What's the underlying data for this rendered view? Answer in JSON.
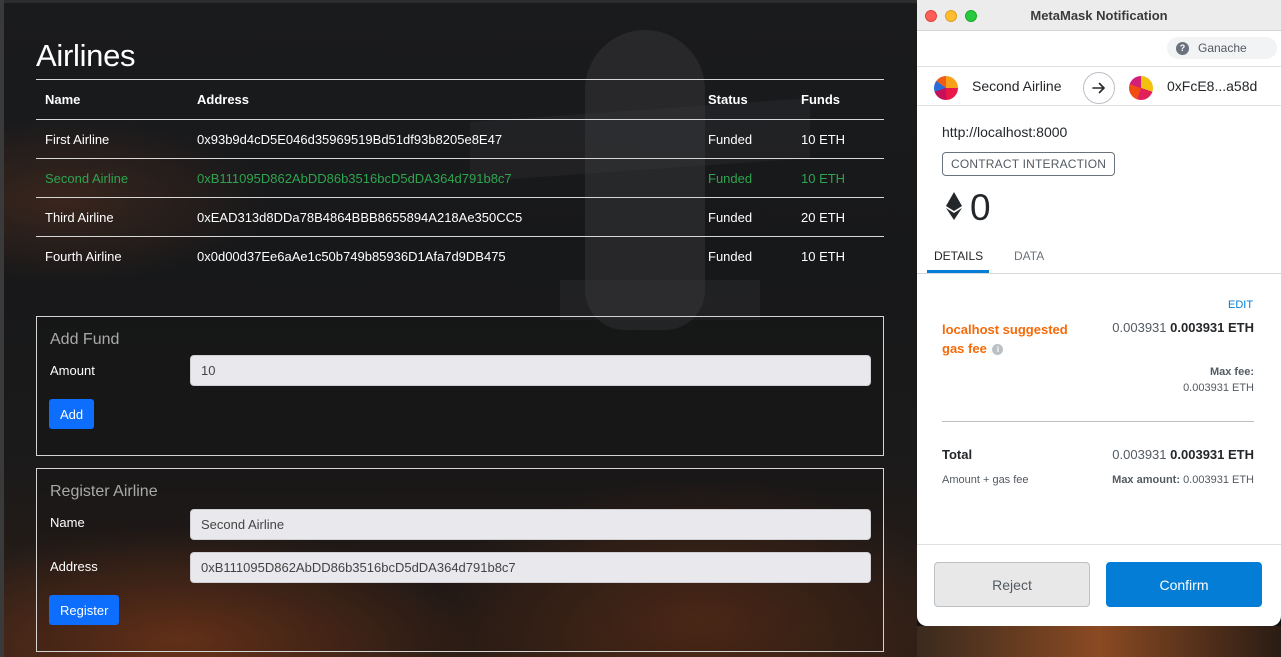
{
  "app": {
    "title": "Airlines",
    "table": {
      "headers": [
        "Name",
        "Address",
        "Status",
        "Funds"
      ],
      "rows": [
        {
          "name": "First Airline",
          "address": "0x93b9d4cD5E046d35969519Bd51df93b8205e8E47",
          "status": "Funded",
          "funds": "10 ETH"
        },
        {
          "name": "Second Airline",
          "address": "0xB111095D862AbDD86b3516bcD5dDA364d791b8c7",
          "status": "Funded",
          "funds": "10 ETH"
        },
        {
          "name": "Third Airline",
          "address": "0xEAD313d8DDa78B4864BBB8655894A218Ae350CC5",
          "status": "Funded",
          "funds": "20 ETH"
        },
        {
          "name": "Fourth Airline",
          "address": "0x0d00d37Ee6aAe1c50b749b85936D1Afa7d9DB475",
          "status": "Funded",
          "funds": "10 ETH"
        }
      ],
      "highlight_color": "#2ea44f"
    },
    "add_fund": {
      "title": "Add Fund",
      "amount_label": "Amount",
      "amount_value": "10",
      "button": "Add"
    },
    "register": {
      "title": "Register Airline",
      "name_label": "Name",
      "name_value": "Second Airline",
      "address_label": "Address",
      "address_value": "0xB111095D862AbDD86b3516bcD5dDA364d791b8c7",
      "button": "Register"
    }
  },
  "metamask": {
    "window_title": "MetaMask Notification",
    "network": "Ganache",
    "from_account": "Second Airline",
    "to_account": "0xFcE8...a58d",
    "origin": "http://localhost:8000",
    "badge": "CONTRACT INTERACTION",
    "amount": "0",
    "tabs": [
      "DETAILS",
      "DATA"
    ],
    "edit": "EDIT",
    "gas_label": "localhost suggested gas fee",
    "gas_value_plain": "0.003931",
    "gas_value_bold": "0.003931 ETH",
    "max_fee_label": "Max fee:",
    "max_fee_value": "0.003931 ETH",
    "total_label": "Total",
    "total_value_plain": "0.003931",
    "total_value_bold": "0.003931 ETH",
    "total_sub_label": "Amount + gas fee",
    "max_amount_label": "Max amount:",
    "max_amount_value": "0.003931 ETH",
    "reject": "Reject",
    "confirm": "Confirm",
    "accent_color": "#037dd6",
    "warning_color": "#f66a0a"
  },
  "icons": [
    "help-icon",
    "ethereum-icon",
    "arrow-right-icon",
    "info-icon"
  ]
}
